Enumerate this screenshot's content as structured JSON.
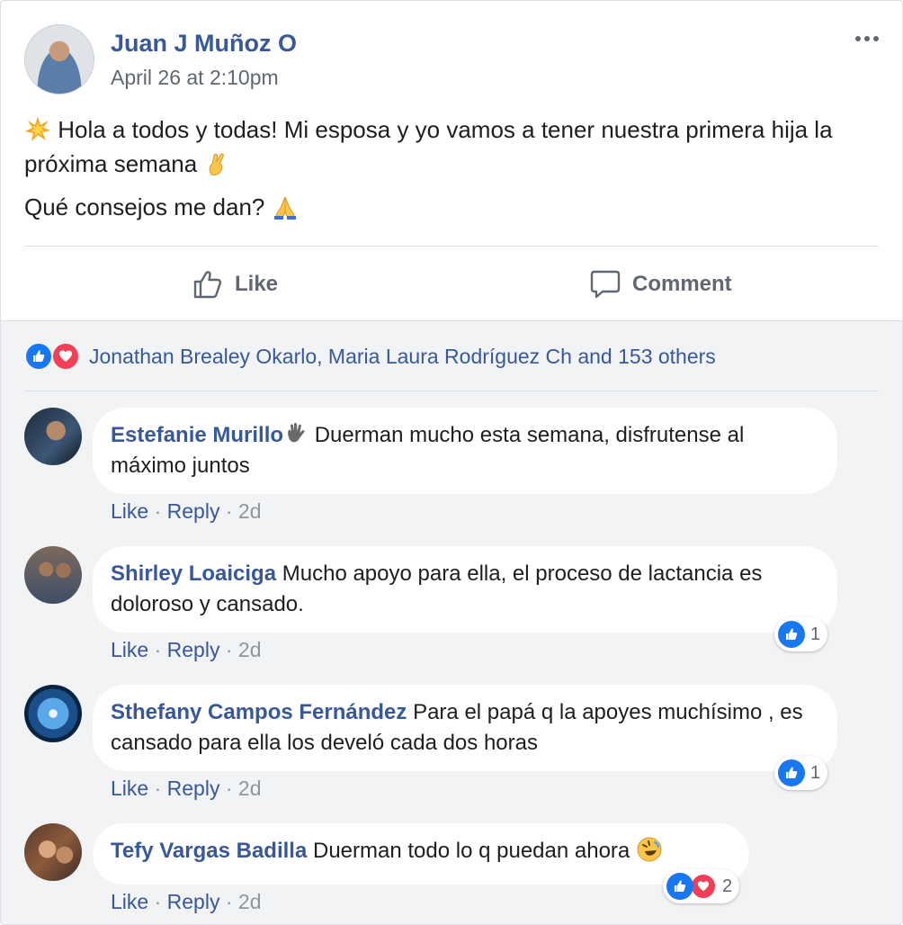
{
  "post": {
    "author": "Juan J Muñoz O",
    "timestamp": "April 26 at 2:10pm",
    "line1": "Hola a todos y todas! Mi esposa y yo vamos a tener nuestra primera hija la próxima semana",
    "line2": "Qué consejos me dan?",
    "emoji_start": "collision-emoji",
    "emoji_mid": "crossed-fingers-emoji",
    "emoji_end": "folded-hands-emoji"
  },
  "actions": {
    "like_label": "Like",
    "comment_label": "Comment"
  },
  "reactions": {
    "summary": "Jonathan Brealey Okarlo, Maria Laura Rodríguez Ch and 153 others",
    "types": [
      "like",
      "love"
    ]
  },
  "comments": [
    {
      "name": "Estefanie Murillo",
      "text": "Duerman mucho esta semana, disfrutense al máximo juntos",
      "emoji": "waving-hand-emoji",
      "like": "Like",
      "reply": "Reply",
      "age": "2d",
      "reaction_count": null
    },
    {
      "name": "Shirley Loaiciga",
      "text": "Mucho apoyo para ella, el proceso de lactancia es doloroso y cansado.",
      "like": "Like",
      "reply": "Reply",
      "age": "2d",
      "reaction_count": "1"
    },
    {
      "name": "Sthefany Campos Fernández",
      "text": "Para el papá q la apoyes muchísimo , es cansado para ella los develó cada dos horas",
      "like": "Like",
      "reply": "Reply",
      "age": "2d",
      "reaction_count": "1"
    },
    {
      "name": "Tefy Vargas Badilla",
      "text": "Duerman todo lo q puedan ahora",
      "emoji": "rolling-laughing-emoji",
      "like": "Like",
      "reply": "Reply",
      "age": "2d",
      "reaction_count": "2"
    }
  ],
  "colors": {
    "link": "#385898",
    "meta": "#90949c",
    "like_blue": "#1877f2",
    "love_red": "#f33e58",
    "comments_bg": "#f2f3f5"
  }
}
